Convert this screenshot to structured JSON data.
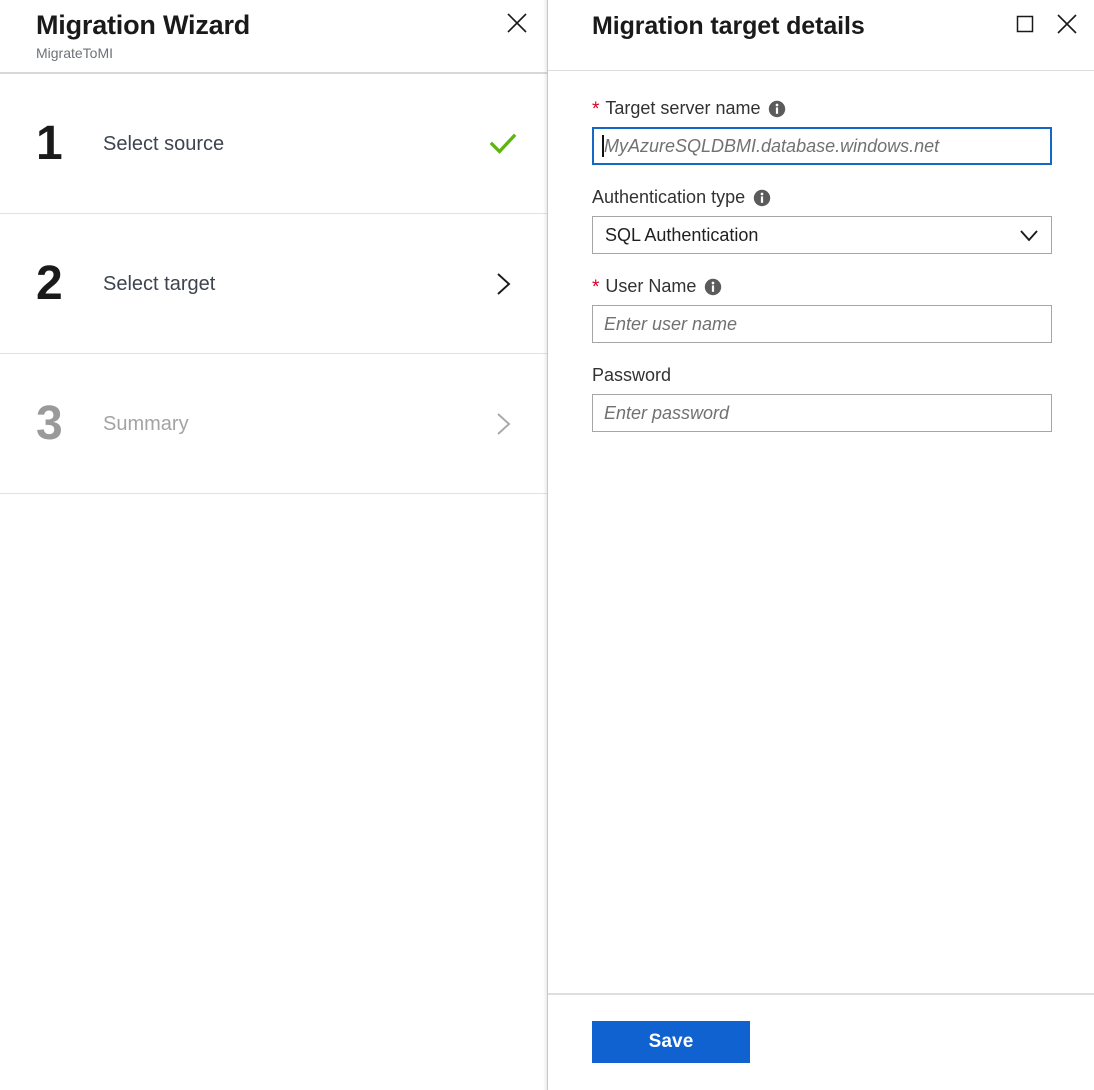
{
  "wizard": {
    "title": "Migration Wizard",
    "subtitle": "MigrateToMI",
    "close_icon": "close-icon",
    "steps": [
      {
        "number": "1",
        "label": "Select source",
        "state": "complete",
        "status_icon": "check-icon"
      },
      {
        "number": "2",
        "label": "Select target",
        "state": "active",
        "status_icon": "chevron-right-icon"
      },
      {
        "number": "3",
        "label": "Summary",
        "state": "disabled",
        "status_icon": "chevron-right-icon"
      }
    ]
  },
  "details": {
    "title": "Migration target details",
    "maximize_icon": "maximize-icon",
    "close_icon": "close-icon",
    "fields": {
      "target_server": {
        "label": "Target server name",
        "required": true,
        "required_marker": "*",
        "info_icon": "info-icon",
        "value": "",
        "placeholder": "MyAzureSQLDBMI.database.windows.net",
        "focused": true
      },
      "auth_type": {
        "label": "Authentication type",
        "required": false,
        "info_icon": "info-icon",
        "selected": "SQL Authentication",
        "options": [
          "SQL Authentication"
        ],
        "chevron_icon": "chevron-down-icon"
      },
      "user_name": {
        "label": "User Name",
        "required": true,
        "required_marker": "*",
        "info_icon": "info-icon",
        "value": "",
        "placeholder": "Enter user name",
        "focused": false
      },
      "password": {
        "label": "Password",
        "required": false,
        "value": "",
        "placeholder": "Enter password",
        "focused": false
      }
    },
    "save_label": "Save"
  },
  "colors": {
    "accent_blue": "#0f62d0",
    "focus_blue": "#1268c3",
    "required_red": "#d70022",
    "success_green": "#5fb50f",
    "border_gray": "#a6a6a6",
    "divider_gray": "#dedede",
    "disabled_gray": "#a3a3a3"
  }
}
